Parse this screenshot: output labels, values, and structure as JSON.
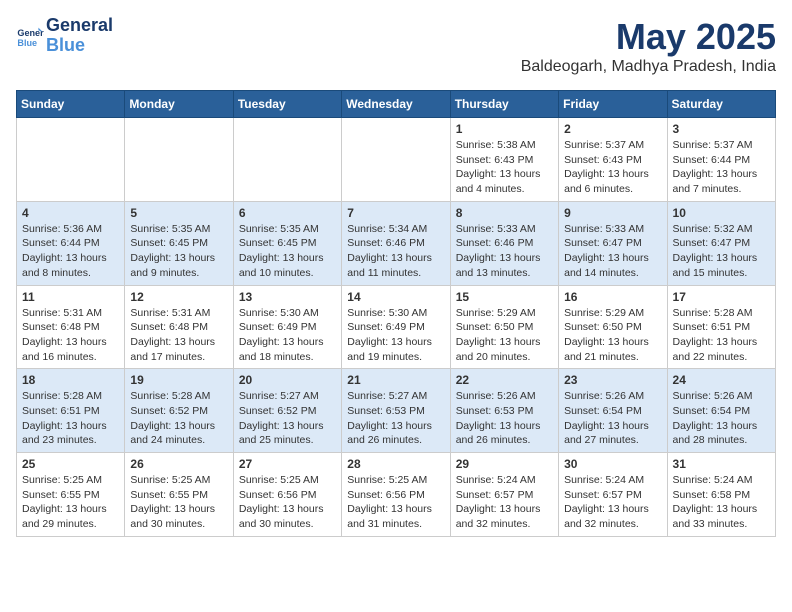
{
  "logo": {
    "line1": "General",
    "line2": "Blue"
  },
  "title": "May 2025",
  "location": "Baldeogarh, Madhya Pradesh, India",
  "weekdays": [
    "Sunday",
    "Monday",
    "Tuesday",
    "Wednesday",
    "Thursday",
    "Friday",
    "Saturday"
  ],
  "weeks": [
    [
      {
        "day": "",
        "info": ""
      },
      {
        "day": "",
        "info": ""
      },
      {
        "day": "",
        "info": ""
      },
      {
        "day": "",
        "info": ""
      },
      {
        "day": "1",
        "info": "Sunrise: 5:38 AM\nSunset: 6:43 PM\nDaylight: 13 hours\nand 4 minutes."
      },
      {
        "day": "2",
        "info": "Sunrise: 5:37 AM\nSunset: 6:43 PM\nDaylight: 13 hours\nand 6 minutes."
      },
      {
        "day": "3",
        "info": "Sunrise: 5:37 AM\nSunset: 6:44 PM\nDaylight: 13 hours\nand 7 minutes."
      }
    ],
    [
      {
        "day": "4",
        "info": "Sunrise: 5:36 AM\nSunset: 6:44 PM\nDaylight: 13 hours\nand 8 minutes."
      },
      {
        "day": "5",
        "info": "Sunrise: 5:35 AM\nSunset: 6:45 PM\nDaylight: 13 hours\nand 9 minutes."
      },
      {
        "day": "6",
        "info": "Sunrise: 5:35 AM\nSunset: 6:45 PM\nDaylight: 13 hours\nand 10 minutes."
      },
      {
        "day": "7",
        "info": "Sunrise: 5:34 AM\nSunset: 6:46 PM\nDaylight: 13 hours\nand 11 minutes."
      },
      {
        "day": "8",
        "info": "Sunrise: 5:33 AM\nSunset: 6:46 PM\nDaylight: 13 hours\nand 13 minutes."
      },
      {
        "day": "9",
        "info": "Sunrise: 5:33 AM\nSunset: 6:47 PM\nDaylight: 13 hours\nand 14 minutes."
      },
      {
        "day": "10",
        "info": "Sunrise: 5:32 AM\nSunset: 6:47 PM\nDaylight: 13 hours\nand 15 minutes."
      }
    ],
    [
      {
        "day": "11",
        "info": "Sunrise: 5:31 AM\nSunset: 6:48 PM\nDaylight: 13 hours\nand 16 minutes."
      },
      {
        "day": "12",
        "info": "Sunrise: 5:31 AM\nSunset: 6:48 PM\nDaylight: 13 hours\nand 17 minutes."
      },
      {
        "day": "13",
        "info": "Sunrise: 5:30 AM\nSunset: 6:49 PM\nDaylight: 13 hours\nand 18 minutes."
      },
      {
        "day": "14",
        "info": "Sunrise: 5:30 AM\nSunset: 6:49 PM\nDaylight: 13 hours\nand 19 minutes."
      },
      {
        "day": "15",
        "info": "Sunrise: 5:29 AM\nSunset: 6:50 PM\nDaylight: 13 hours\nand 20 minutes."
      },
      {
        "day": "16",
        "info": "Sunrise: 5:29 AM\nSunset: 6:50 PM\nDaylight: 13 hours\nand 21 minutes."
      },
      {
        "day": "17",
        "info": "Sunrise: 5:28 AM\nSunset: 6:51 PM\nDaylight: 13 hours\nand 22 minutes."
      }
    ],
    [
      {
        "day": "18",
        "info": "Sunrise: 5:28 AM\nSunset: 6:51 PM\nDaylight: 13 hours\nand 23 minutes."
      },
      {
        "day": "19",
        "info": "Sunrise: 5:28 AM\nSunset: 6:52 PM\nDaylight: 13 hours\nand 24 minutes."
      },
      {
        "day": "20",
        "info": "Sunrise: 5:27 AM\nSunset: 6:52 PM\nDaylight: 13 hours\nand 25 minutes."
      },
      {
        "day": "21",
        "info": "Sunrise: 5:27 AM\nSunset: 6:53 PM\nDaylight: 13 hours\nand 26 minutes."
      },
      {
        "day": "22",
        "info": "Sunrise: 5:26 AM\nSunset: 6:53 PM\nDaylight: 13 hours\nand 26 minutes."
      },
      {
        "day": "23",
        "info": "Sunrise: 5:26 AM\nSunset: 6:54 PM\nDaylight: 13 hours\nand 27 minutes."
      },
      {
        "day": "24",
        "info": "Sunrise: 5:26 AM\nSunset: 6:54 PM\nDaylight: 13 hours\nand 28 minutes."
      }
    ],
    [
      {
        "day": "25",
        "info": "Sunrise: 5:25 AM\nSunset: 6:55 PM\nDaylight: 13 hours\nand 29 minutes."
      },
      {
        "day": "26",
        "info": "Sunrise: 5:25 AM\nSunset: 6:55 PM\nDaylight: 13 hours\nand 30 minutes."
      },
      {
        "day": "27",
        "info": "Sunrise: 5:25 AM\nSunset: 6:56 PM\nDaylight: 13 hours\nand 30 minutes."
      },
      {
        "day": "28",
        "info": "Sunrise: 5:25 AM\nSunset: 6:56 PM\nDaylight: 13 hours\nand 31 minutes."
      },
      {
        "day": "29",
        "info": "Sunrise: 5:24 AM\nSunset: 6:57 PM\nDaylight: 13 hours\nand 32 minutes."
      },
      {
        "day": "30",
        "info": "Sunrise: 5:24 AM\nSunset: 6:57 PM\nDaylight: 13 hours\nand 32 minutes."
      },
      {
        "day": "31",
        "info": "Sunrise: 5:24 AM\nSunset: 6:58 PM\nDaylight: 13 hours\nand 33 minutes."
      }
    ]
  ]
}
